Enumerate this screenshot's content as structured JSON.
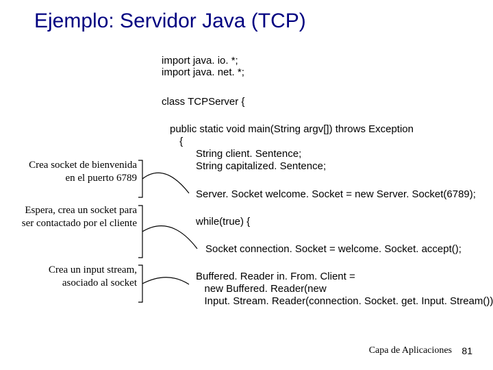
{
  "title": "Ejemplo: Servidor Java (TCP)",
  "code": {
    "imports": "import java. io. *;\nimport java. net. *;",
    "classdecl": "class TCPServer {",
    "mainsig": "public static void main(String argv[]) throws Exception",
    "brace": " {",
    "l1": "String client. Sentence;",
    "l2": "String capitalized. Sentence;",
    "l3": "Server. Socket welcome. Socket = new Server. Socket(6789);",
    "l4": "while(true) {",
    "l5": "Socket connection. Socket = welcome. Socket. accept();",
    "l6": "Buffered. Reader in. From. Client =",
    "l7": "   new Buffered. Reader(new",
    "l8": "   Input. Stream. Reader(connection. Socket. get. Input. Stream()));"
  },
  "annotations": {
    "a1": "Crea\nsocket de bienvenida\nen el puerto 6789",
    "a2": "Espera,\ncrea un socket\npara ser contactado\npor el cliente",
    "a3": "Crea un input\nstream, asociado\nal socket"
  },
  "footer": {
    "label": "Capa de Aplicaciones",
    "page": "81"
  }
}
